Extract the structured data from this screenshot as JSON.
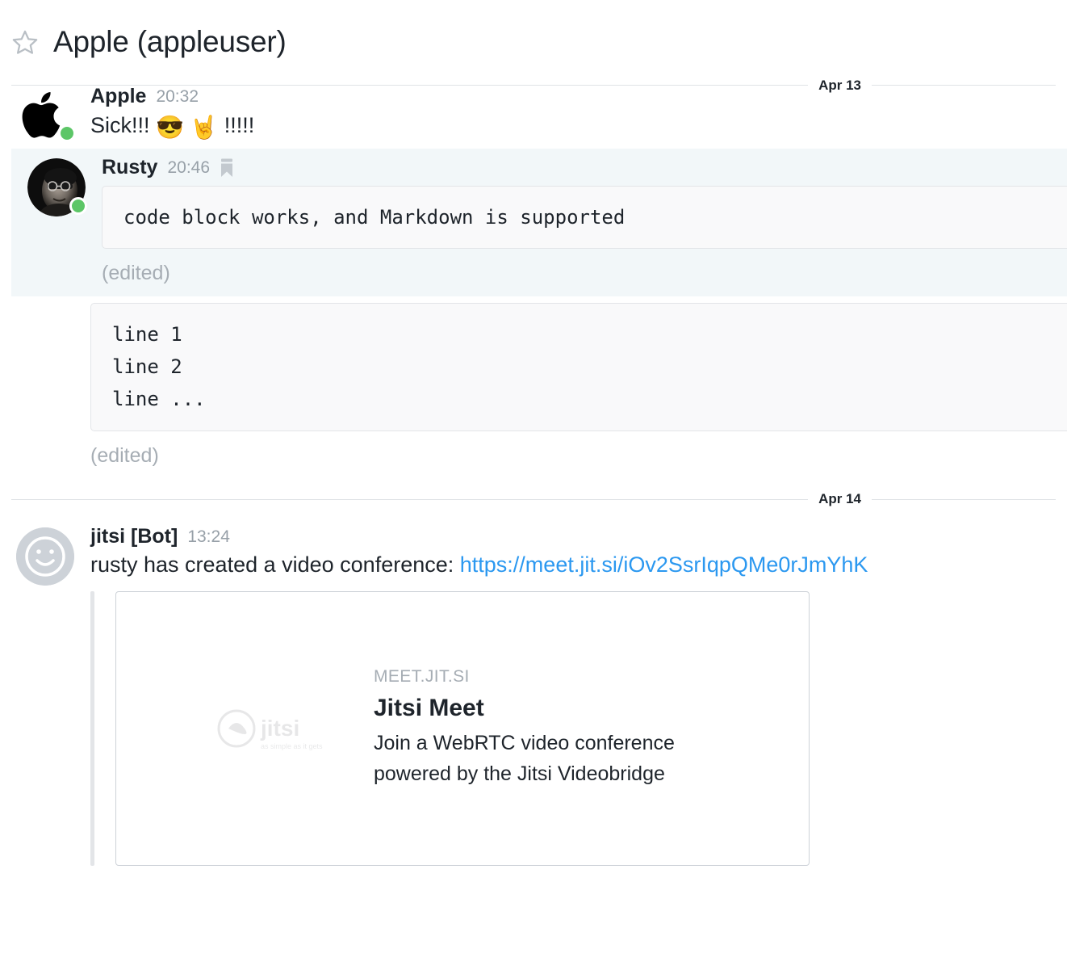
{
  "header": {
    "star_icon": "star-outline-icon",
    "title": "Apple (appleuser)"
  },
  "dividers": {
    "apr13": "Apr 13",
    "apr14": "Apr 14"
  },
  "messages": [
    {
      "id": "apple-sick",
      "author": "Apple",
      "time": "20:32",
      "avatar_icon": "apple-logo-avatar",
      "status": "online",
      "text": "Sick!!! ",
      "emoji1": "😎",
      "emoji2": "🤘",
      "text_tail": " !!!!!"
    },
    {
      "id": "rusty-code",
      "author": "Rusty",
      "time": "20:46",
      "avatar_icon": "rusty-photo-avatar",
      "bookmark_icon": "bookmark-icon",
      "status": "online",
      "code": "code block works, and Markdown is supported",
      "edited": "(edited)"
    },
    {
      "id": "rusty-lines",
      "code": "line 1\nline 2\nline ...",
      "edited": "(edited)"
    },
    {
      "id": "jitsi-bot",
      "author": "jitsi [Bot]",
      "time": "13:24",
      "avatar_icon": "smiley-bot-avatar",
      "text_prefix": "rusty has created a video conference: ",
      "link_text": "https://meet.jit.si/iOv2SsrIqpQMe0rJmYhK",
      "attachment": {
        "site": "MEET.JIT.SI",
        "title": "Jitsi Meet",
        "description": "Join a WebRTC video conference powered by the Jitsi Videobridge",
        "logo_icon": "jitsi-logo-icon"
      }
    }
  ],
  "colors": {
    "link": "#2b98f0",
    "online": "#5cc667",
    "highlight_bg": "#f2f7f9",
    "code_bg": "#f9f9fa",
    "muted_text": "#97a0a8",
    "border": "#e3e5e8"
  }
}
